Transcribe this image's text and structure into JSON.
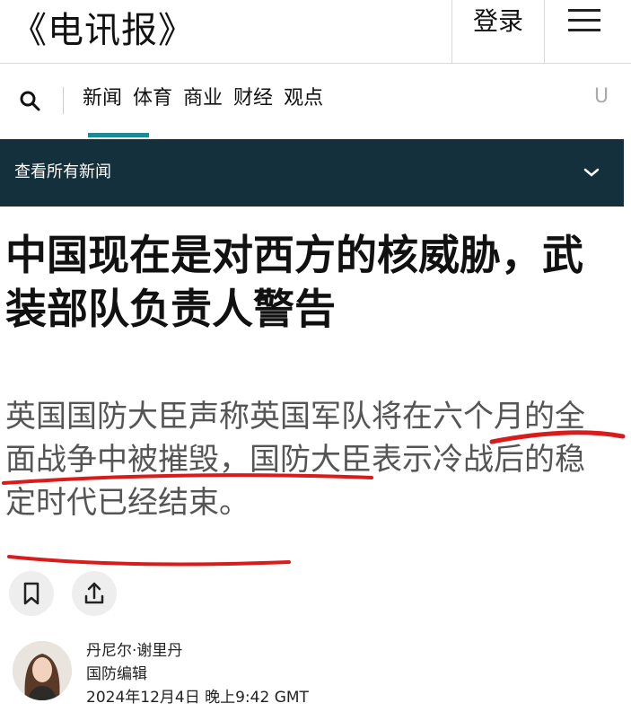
{
  "header": {
    "brand": "《电讯报》",
    "login_label": "登录"
  },
  "nav": {
    "items": [
      "新闻",
      "体育",
      "商业",
      "财经",
      "观点"
    ],
    "overflow_glyph": "U"
  },
  "section_bar": {
    "label": "查看所有新闻"
  },
  "article": {
    "headline": "中国现在是对西方的核威胁，武装部队负责人警告",
    "standfirst": "英国国防大臣声称英国军队将在六个月的全面战争中被摧毁，国防大臣表示冷战后的稳定时代已经结束。",
    "author_name": "丹尼尔·谢里丹",
    "author_role": "国防编辑",
    "timestamp": "2024年12月4日 晚上9:42 GMT"
  },
  "colors": {
    "section_bar_bg": "#15303d",
    "nav_active_underline": "#1e8a93",
    "annotation_red": "#d81b1b"
  },
  "icons": {
    "search": "search-icon",
    "menu": "hamburger-menu-icon",
    "chevron": "chevron-down-icon",
    "bookmark": "bookmark-icon",
    "share": "share-icon"
  }
}
